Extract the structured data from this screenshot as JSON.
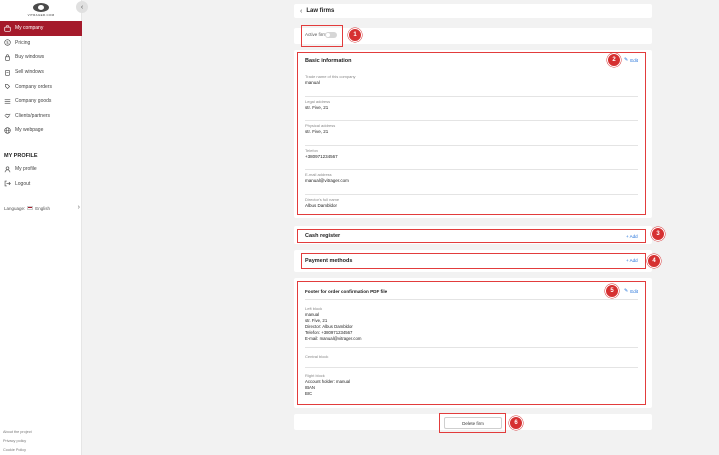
{
  "logo": {
    "text": "VITRAGER.COM"
  },
  "sidebar": {
    "collapse_icon": "chevron-left-icon",
    "items": [
      {
        "label": "My company",
        "icon": "briefcase-icon",
        "active": true
      },
      {
        "label": "Pricing",
        "icon": "dollar-icon"
      },
      {
        "label": "Buy windows",
        "icon": "bag-icon"
      },
      {
        "label": "Sell windows",
        "icon": "tag-icon"
      },
      {
        "label": "Company orders",
        "icon": "orders-icon"
      },
      {
        "label": "Company goods",
        "icon": "list-icon"
      },
      {
        "label": "Clients/partners",
        "icon": "handshake-icon"
      },
      {
        "label": "My webpage",
        "icon": "globe-icon"
      }
    ],
    "profile_title": "MY PROFILE",
    "profile_items": [
      {
        "label": "My profile",
        "icon": "user-icon"
      },
      {
        "label": "Logout",
        "icon": "logout-icon"
      }
    ],
    "language_label": "Language:",
    "language_value": "English",
    "footer_links": [
      "About the project",
      "Privacy policy",
      "Cookie Policy"
    ]
  },
  "header": {
    "title": "Law firms",
    "back_icon": "chevron-left-icon"
  },
  "active_firm": {
    "label": "Active firm",
    "enabled": false
  },
  "badges": [
    "1",
    "2",
    "3",
    "4",
    "5",
    "6"
  ],
  "basic_info": {
    "title": "Basic information",
    "edit_label": "Edit",
    "fields": [
      {
        "label": "Trade name of this company",
        "value": "manual"
      },
      {
        "label": "Legal address",
        "value": "str. Five, 21"
      },
      {
        "label": "Physical address",
        "value": "str. Five, 21"
      },
      {
        "label": "Telefon",
        "value": "+380971234567"
      },
      {
        "label": "E-mail address",
        "value": "manual@vitrager.com"
      },
      {
        "label": "Director's full name",
        "value": "Albus Dambldor"
      }
    ]
  },
  "cash_register": {
    "title": "Cash register",
    "add_label": "+ Add"
  },
  "payment_methods": {
    "title": "Payment methods",
    "add_label": "+ Add"
  },
  "footer_pdf": {
    "title": "Footer for order confirmation PDF file",
    "edit_label": "Edit",
    "left_block": {
      "label": "Left block",
      "lines": [
        "manual",
        "str. Five, 21",
        "Director: Albus Dambldor",
        "Telefon: +380971234567",
        "E-mail: manual@vitrager.com"
      ]
    },
    "central_block": {
      "label": "Central block"
    },
    "right_block": {
      "label": "Right block",
      "lines": [
        "Account holder: manual",
        "IBAN",
        "BIC"
      ]
    }
  },
  "delete": {
    "label": "Delete firm"
  },
  "colors": {
    "accent": "#a51a2b",
    "annotation": "#d63031",
    "link": "#1e6fd9"
  }
}
